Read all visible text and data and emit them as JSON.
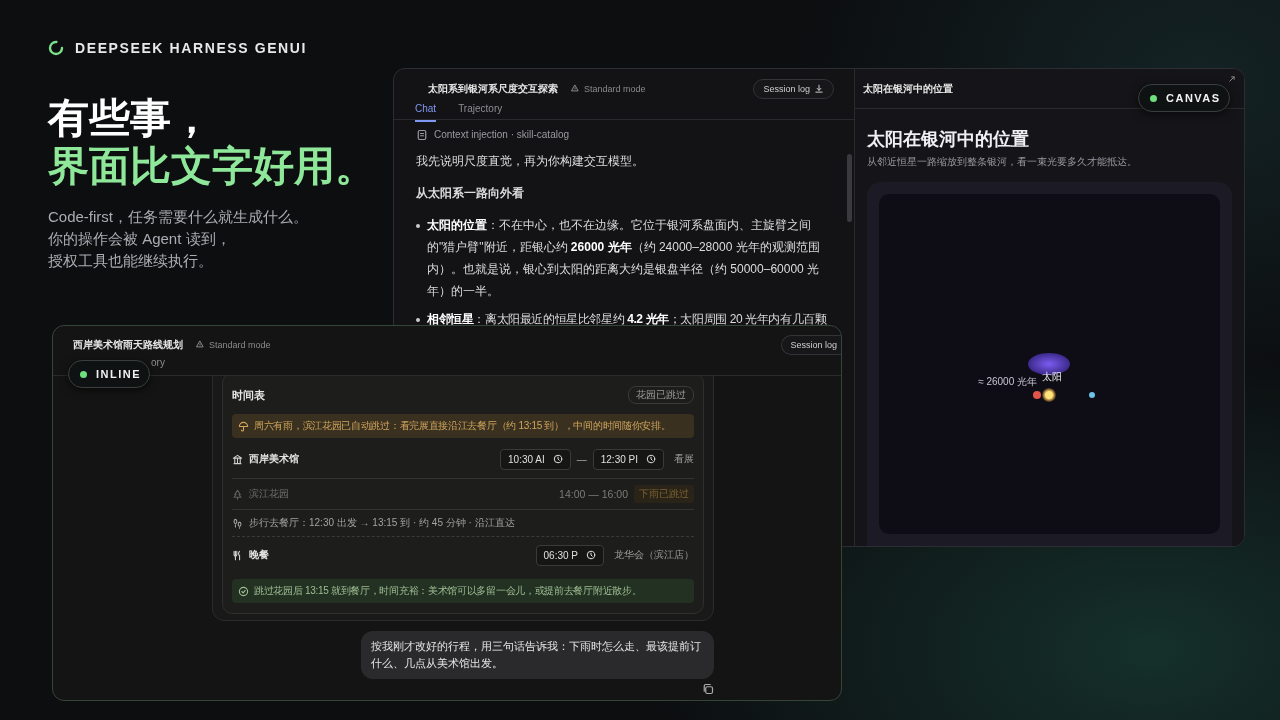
{
  "brand": {
    "name": "DEEPSEEK HARNESS GENUI"
  },
  "hero": {
    "headline": "有些事，",
    "highlight": "界面比文字好用。",
    "description": [
      "Code-first，任务需要什么就生成什么。",
      "你的操作会被 Agent 读到，",
      "授权工具也能继续执行。"
    ]
  },
  "chat_window": {
    "title": "太阳系到银河系尺度交互探索",
    "mode": "Standard mode",
    "session_button": "Session log",
    "tabs": [
      {
        "label": "Chat",
        "selected": true
      },
      {
        "label": "Trajectory",
        "selected": false
      }
    ],
    "context": "Context injection · skill-catalog",
    "messages": [
      {
        "kind": "paragraph",
        "text": "我先说明尺度直觉，再为你构建交互模型。"
      },
      {
        "kind": "heading",
        "text": "从太阳系一路向外看"
      },
      {
        "kind": "bullet",
        "text": "**太阳的位置**：不在中心，也不在边缘。它位于银河系盘面内、主旋臂之间的\"猎户臂\"附近，距银心约 **26000 光年**（约 24000–28000 光年的观测范围内）。也就是说，银心到太阳的距离大约是银盘半径（约 50000–60000 光年）的一半。"
      },
      {
        "kind": "bullet",
        "text": "**相邻恒星**：离太阳最近的恒星比邻星约 **4.2 光年**；太阳周围 20 光年内有几百颗"
      }
    ]
  },
  "canvas_panel": {
    "title": "太阳在银河中的位置",
    "heading": "太阳在银河中的位置",
    "subtitle": "从邻近恒星一路缩放到整条银河，看一束光要多久才能抵达。",
    "diagram": {
      "distance_label": "≈ 26000 光年",
      "sun_label": "太阳"
    }
  },
  "canvas_badge": {
    "label": "CANVAS"
  },
  "inline_window": {
    "title": "西岸美术馆雨天路线规划",
    "mode": "Standard mode",
    "session_button": "Session log",
    "tabs": [
      {
        "label": "ory",
        "selected": false
      }
    ],
    "schedule": {
      "title": "时间表",
      "tag": "花园已跳过",
      "alert": {
        "kind": "warning",
        "text": "周六有雨，滨江花园已自动跳过：看完展直接沿江去餐厅（约 13:15 到），中间的时间随你安排。"
      },
      "rows": [
        {
          "kind": "museum",
          "name": "西岸美术馆",
          "skipped": false,
          "times": [
            "10:30 AI",
            "12:30 PI"
          ],
          "separator": "—",
          "note": "看展"
        },
        {
          "kind": "garden",
          "name": "滨江花园",
          "skipped": true,
          "time_range": "14:00 — 16:00",
          "tag": "下雨已跳过"
        },
        {
          "kind": "walk",
          "text": "步行去餐厅：12:30 出发 → 13:15 到 · 约 45 分钟 · 沿江直达"
        },
        {
          "kind": "dinner",
          "name": "晚餐",
          "skipped": false,
          "times": [
            "06:30 P"
          ],
          "note": "龙华会（滨江店）"
        }
      ],
      "summary": {
        "kind": "success",
        "text": "跳过花园后 13:15 就到餐厅，时间充裕：美术馆可以多留一会儿，或提前去餐厅附近散步。"
      }
    },
    "user_message": "按我刚才改好的行程，用三句话告诉我：下雨时怎么走、最该提前订什么、几点从美术馆出发。"
  },
  "inline_badge": {
    "label": "INLINE"
  }
}
